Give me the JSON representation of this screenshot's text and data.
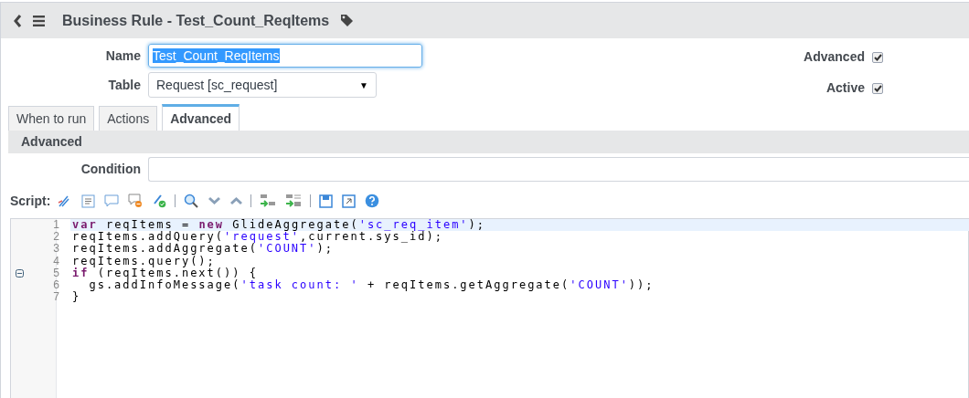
{
  "header": {
    "title": "Business Rule - Test_Count_ReqItems"
  },
  "fields": {
    "name": {
      "label": "Name",
      "value": "Test_Count_ReqItems"
    },
    "table": {
      "label": "Table",
      "value": "Request [sc_request]",
      "caret": "▼"
    }
  },
  "flags": [
    {
      "label": "Advanced",
      "checked": true
    },
    {
      "label": "Active",
      "checked": true
    }
  ],
  "tabs": [
    {
      "label": "When to run",
      "selected": false
    },
    {
      "label": "Actions",
      "selected": false
    },
    {
      "label": "Advanced",
      "selected": true
    }
  ],
  "section": {
    "title": "Advanced",
    "condition_label": "Condition",
    "script_label": "Script:"
  },
  "code_lines": [
    {
      "number": "1",
      "active": true,
      "fold": false,
      "tokens": [
        {
          "kind": "keyword",
          "text": "var"
        },
        {
          "kind": "plain",
          "text": " reqItems = "
        },
        {
          "kind": "keyword",
          "text": "new"
        },
        {
          "kind": "plain",
          "text": " GlideAggregate("
        },
        {
          "kind": "string",
          "text": "'sc_req_item'"
        },
        {
          "kind": "plain",
          "text": ");"
        }
      ]
    },
    {
      "number": "2",
      "active": false,
      "fold": false,
      "tokens": [
        {
          "kind": "plain",
          "text": "reqItems.addQuery("
        },
        {
          "kind": "string",
          "text": "'request'"
        },
        {
          "kind": "plain",
          "text": ",current.sys_id);"
        }
      ]
    },
    {
      "number": "3",
      "active": false,
      "fold": false,
      "tokens": [
        {
          "kind": "plain",
          "text": "reqItems.addAggregate("
        },
        {
          "kind": "string",
          "text": "'COUNT'"
        },
        {
          "kind": "plain",
          "text": ");"
        }
      ]
    },
    {
      "number": "4",
      "active": false,
      "fold": false,
      "tokens": [
        {
          "kind": "plain",
          "text": "reqItems.query();"
        }
      ]
    },
    {
      "number": "5",
      "active": false,
      "fold": true,
      "tokens": [
        {
          "kind": "keyword",
          "text": "if"
        },
        {
          "kind": "plain",
          "text": " (reqItems.next()) {"
        }
      ]
    },
    {
      "number": "6",
      "active": false,
      "fold": false,
      "tokens": [
        {
          "kind": "plain",
          "text": "  gs.addInfoMessage("
        },
        {
          "kind": "string",
          "text": "'task count: '"
        },
        {
          "kind": "plain",
          "text": " + reqItems.getAggregate("
        },
        {
          "kind": "string",
          "text": "'COUNT'"
        },
        {
          "kind": "plain",
          "text": "));"
        }
      ]
    },
    {
      "number": "7",
      "active": false,
      "fold": false,
      "tokens": [
        {
          "kind": "plain",
          "text": "}"
        }
      ]
    }
  ]
}
